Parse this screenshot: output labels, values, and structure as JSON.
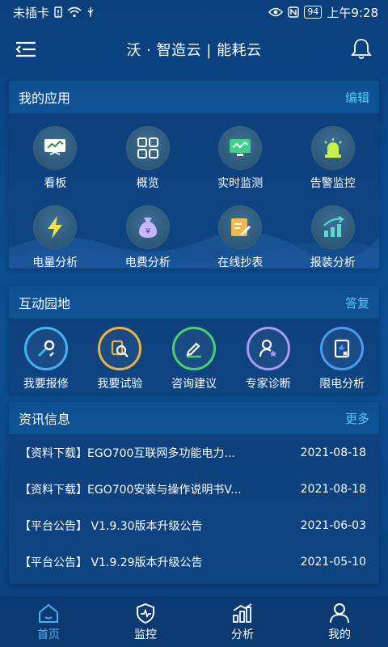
{
  "status_bar": {
    "carrier": "未插卡",
    "battery": "94",
    "time": "上午9:28"
  },
  "header": {
    "title": "沃 · 智造云 | 能耗云"
  },
  "apps": {
    "title": "我的应用",
    "action": "编辑",
    "items": [
      {
        "label": "看板",
        "icon": "dashboard-icon"
      },
      {
        "label": "概览",
        "icon": "grid-icon"
      },
      {
        "label": "实时监测",
        "icon": "monitor-icon"
      },
      {
        "label": "告警监控",
        "icon": "alarm-light-icon"
      },
      {
        "label": "电量分析",
        "icon": "lightning-icon"
      },
      {
        "label": "电费分析",
        "icon": "money-bag-icon"
      },
      {
        "label": "在线抄表",
        "icon": "edit-note-icon"
      },
      {
        "label": "报装分析",
        "icon": "trend-chart-icon"
      }
    ]
  },
  "interact": {
    "title": "互动园地",
    "action": "答复",
    "items": [
      {
        "label": "我要报修",
        "icon": "repair-wrench-icon"
      },
      {
        "label": "我要试验",
        "icon": "test-search-icon"
      },
      {
        "label": "咨询建议",
        "icon": "write-advice-icon"
      },
      {
        "label": "专家诊断",
        "icon": "expert-user-icon"
      },
      {
        "label": "限电分析",
        "icon": "power-limit-doc-icon"
      }
    ]
  },
  "news": {
    "title": "资讯信息",
    "action": "更多",
    "items": [
      {
        "title": "【资料下载】EGO700互联网多功能电力...",
        "date": "2021-08-18"
      },
      {
        "title": "【资料下载】EGO700安装与操作说明书V...",
        "date": "2021-08-18"
      },
      {
        "title": "【平台公告】 V1.9.30版本升级公告",
        "date": "2021-06-03"
      },
      {
        "title": "【平台公告】 V1.9.29版本升级公告",
        "date": "2021-05-10"
      }
    ]
  },
  "tabs": [
    {
      "label": "首页",
      "icon": "home-icon"
    },
    {
      "label": "监控",
      "icon": "monitor-shield-icon"
    },
    {
      "label": "分析",
      "icon": "analysis-bars-icon"
    },
    {
      "label": "我的",
      "icon": "user-icon"
    }
  ],
  "colors": {
    "accent": "#3fb6f0",
    "link": "#55c8f6"
  }
}
